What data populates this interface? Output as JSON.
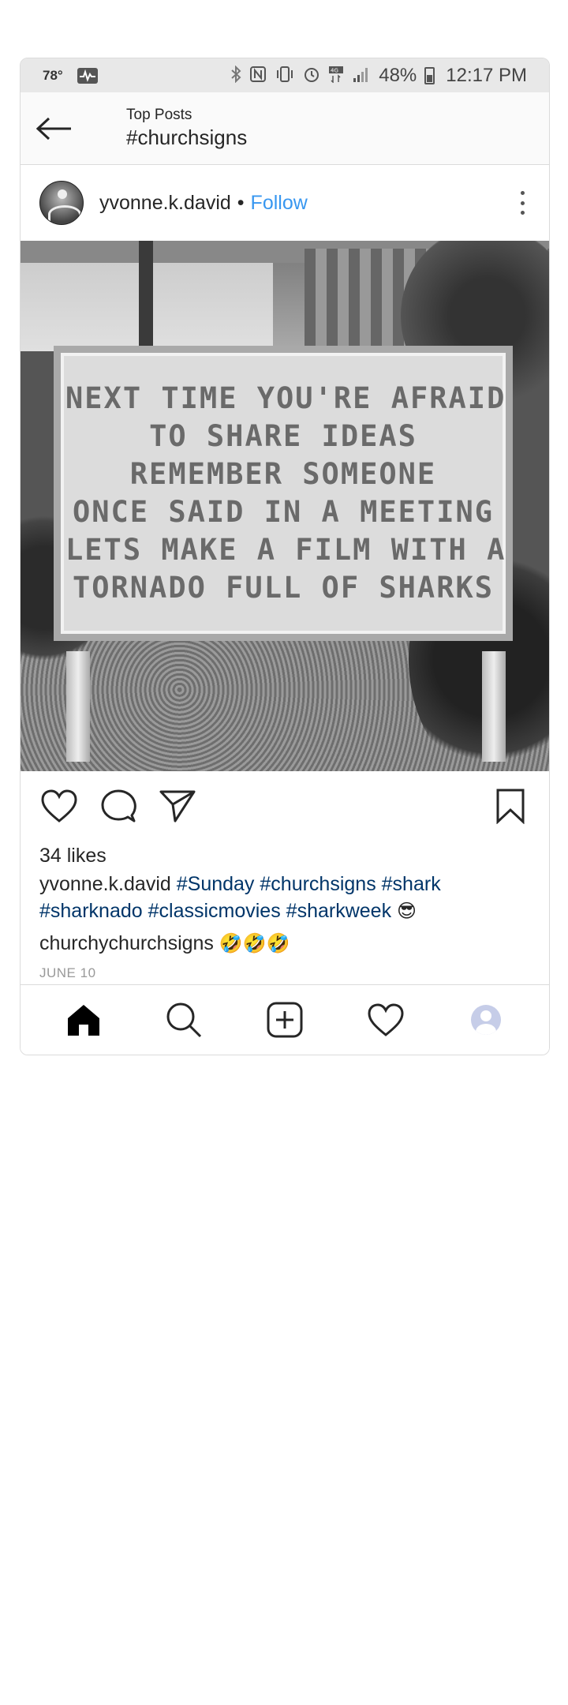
{
  "status_bar": {
    "temperature": "78°",
    "battery_pct": "48%",
    "time": "12:17 PM",
    "icons": [
      "pulse-icon",
      "bluetooth-icon",
      "nfc-icon",
      "vibrate-icon",
      "alarm-icon",
      "4g-icon",
      "signal-icon",
      "battery-icon"
    ]
  },
  "header": {
    "subtitle": "Top Posts",
    "title": "#churchsigns"
  },
  "post": {
    "username": "yvonne.k.david",
    "separator": "•",
    "follow_label": "Follow",
    "sign_lines": [
      "NEXT TIME YOU'RE AFRAID",
      "TO  SHARE IDEAS",
      "REMEMBER SOMEONE",
      "ONCE  SAID IN A MEETING",
      "LETS MAKE A FILM WITH A",
      "TORNADO FULL OF SHARKS"
    ],
    "likes": "34 likes",
    "caption_user": "yvonne.k.david",
    "tags": [
      "#Sunday",
      "#churchsigns",
      "#shark",
      "#sharknado",
      "#classicmovies",
      "#sharkweek"
    ],
    "caption_emoji": "😎",
    "comment_user": "churchychurchsigns",
    "comment_emoji": "🤣🤣🤣",
    "date": "JUNE 10"
  },
  "bottom_nav": [
    "home-icon",
    "search-icon",
    "add-icon",
    "activity-heart-icon",
    "profile-avatar"
  ],
  "colors": {
    "link_blue": "#3897f0",
    "hashtag_blue": "#003569",
    "text": "#262626",
    "muted": "#999999",
    "status_bar_bg": "#e8e8e8"
  }
}
